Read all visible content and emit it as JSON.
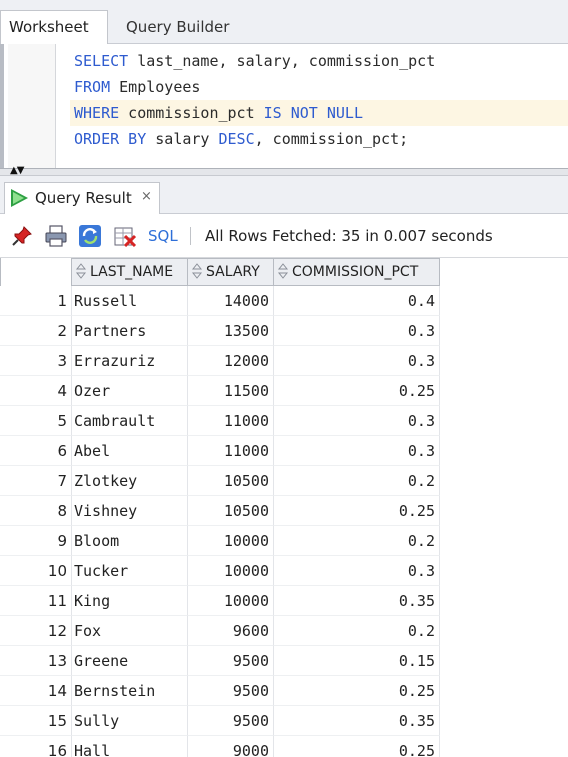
{
  "editor_tabs": [
    "Worksheet",
    "Query Builder"
  ],
  "sql_lines": [
    [
      {
        "t": "kw",
        "s": "SELECT"
      },
      {
        "t": "id",
        "s": " last_name, salary, commission_pct"
      }
    ],
    [
      {
        "t": "kw",
        "s": "FROM"
      },
      {
        "t": "id",
        "s": " Employees"
      }
    ],
    [
      {
        "t": "kw",
        "s": "WHERE"
      },
      {
        "t": "id",
        "s": " commission_pct "
      },
      {
        "t": "kw",
        "s": "IS NOT NULL"
      }
    ],
    [
      {
        "t": "kw",
        "s": "ORDER BY"
      },
      {
        "t": "id",
        "s": " salary "
      },
      {
        "t": "kw",
        "s": "DESC"
      },
      {
        "t": "id",
        "s": ", commission_pct;"
      }
    ]
  ],
  "result_tab": {
    "label": "Query Result",
    "close": "×"
  },
  "toolbar": {
    "sql_label": "SQL",
    "status": "All Rows Fetched: 35 in 0.007 seconds"
  },
  "columns": [
    "LAST_NAME",
    "SALARY",
    "COMMISSION_PCT"
  ],
  "rows": [
    {
      "n": "1",
      "name": "Russell",
      "salary": "14000",
      "comm": "0.4"
    },
    {
      "n": "2",
      "name": "Partners",
      "salary": "13500",
      "comm": "0.3"
    },
    {
      "n": "3",
      "name": "Errazuriz",
      "salary": "12000",
      "comm": "0.3"
    },
    {
      "n": "4",
      "name": "Ozer",
      "salary": "11500",
      "comm": "0.25"
    },
    {
      "n": "5",
      "name": "Cambrault",
      "salary": "11000",
      "comm": "0.3"
    },
    {
      "n": "6",
      "name": "Abel",
      "salary": "11000",
      "comm": "0.3"
    },
    {
      "n": "7",
      "name": "Zlotkey",
      "salary": "10500",
      "comm": "0.2"
    },
    {
      "n": "8",
      "name": "Vishney",
      "salary": "10500",
      "comm": "0.25"
    },
    {
      "n": "9",
      "name": "Bloom",
      "salary": "10000",
      "comm": "0.2"
    },
    {
      "n": "10",
      "name": "Tucker",
      "salary": "10000",
      "comm": "0.3"
    },
    {
      "n": "11",
      "name": "King",
      "salary": "10000",
      "comm": "0.35"
    },
    {
      "n": "12",
      "name": "Fox",
      "salary": "9600",
      "comm": "0.2"
    },
    {
      "n": "13",
      "name": "Greene",
      "salary": "9500",
      "comm": "0.15"
    },
    {
      "n": "14",
      "name": "Bernstein",
      "salary": "9500",
      "comm": "0.25"
    },
    {
      "n": "15",
      "name": "Sully",
      "salary": "9500",
      "comm": "0.35"
    },
    {
      "n": "16",
      "name": "Hall",
      "salary": "9000",
      "comm": "0.25"
    }
  ],
  "colors": {
    "keyword": "#2e5bcf",
    "accent": "#2e6fd8"
  }
}
